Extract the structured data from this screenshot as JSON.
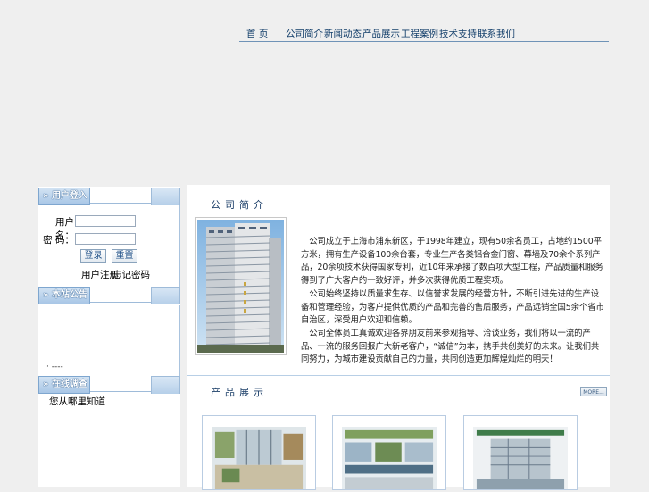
{
  "nav": {
    "items": [
      "首 页",
      "公司简介",
      "新闻动态",
      "产品展示",
      "工程案例",
      "技术支持",
      "联系我们"
    ]
  },
  "sidebar": {
    "login": {
      "heading": "» 用户登入",
      "username_label": "用户名：",
      "password_label": "密  码：",
      "username_value": "",
      "password_value": "",
      "login_button": "登录",
      "reset_button": "重置",
      "register_link": "用户注册",
      "forgot_link": "忘记密码"
    },
    "notice": {
      "heading": "» 本站公告",
      "item": "· ----"
    },
    "survey": {
      "heading": "» 在线调查",
      "question": "您从哪里知道"
    }
  },
  "main": {
    "intro": {
      "title": "公司简介",
      "paragraphs": [
        "　公司成立于上海市浦东新区，于1998年建立，现有50余名员工，占地约1500平方米，拥有生产设备100余台套，专业生产各类铝合金门窗、幕墙及70余个系列产品，20余项技术获得国家专利，近10年来承接了数百项大型工程，产品质量和服务得到了广大客户的一致好评，并多次获得优质工程奖项。",
        "　公司始终坚持以质量求生存、以信誉求发展的经营方针，不断引进先进的生产设备和管理经验，为客户提供优质的产品和完善的售后服务，产品远销全国5余个省市自治区，深受用户欢迎和信赖。",
        "　公司全体员工真诚欢迎各界朋友前来参观指导、洽谈业务，我们将以一流的产品、一流的服务回报广大新老客户，“诚信”为本，携手共创美好的未来。让我们共同努力，为城市建设贡献自己的力量，共同创造更加辉煌灿烂的明天！"
      ]
    },
    "products": {
      "title": "产品展示",
      "more_label": "MORE..."
    }
  },
  "colors": {
    "page_bg": "#efefef",
    "nav_text": "#123e6a",
    "accent_blue": "#7ea6cf"
  }
}
